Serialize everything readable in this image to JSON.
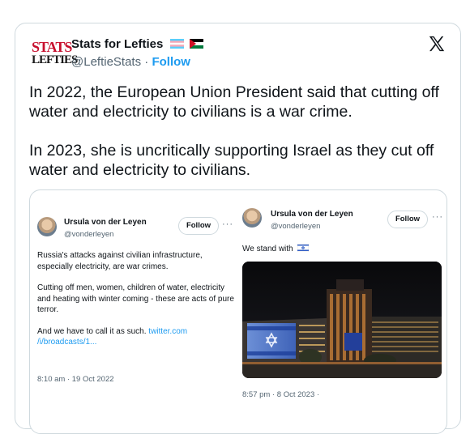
{
  "tweet": {
    "logo_line1": "STATS",
    "logo_line2": "LEFTIES",
    "author_name": "Stats for Lefties",
    "author_handle": "@LeftieStats",
    "separator": "·",
    "follow_label": "Follow",
    "paragraphs": [
      "In 2022, the European Union President said that cutting off water and electricity to civilians is a war crime.",
      "In 2023, she is uncritically supporting Israel as they cut off water and electricity to civilians."
    ]
  },
  "embedded_left": {
    "name": "Ursula von der Leyen",
    "handle": "@vonderleyen",
    "follow_label": "Follow",
    "more": "···",
    "p1": "Russia's attacks against civilian infrastructure, especially electricity, are war crimes.",
    "p2": "Cutting off men, women, children of water, electricity and heating with winter coming - these are acts of pure terror.",
    "p3_text": "And we have to call it as such. ",
    "p3_link": "twitter.com /i/broadcasts/1...",
    "timestamp": "8:10 am · 19 Oct 2022"
  },
  "embedded_right": {
    "name": "Ursula von der Leyen",
    "handle": "@vonderleyen",
    "follow_label": "Follow",
    "more": "···",
    "text": "We stand with",
    "timestamp": "8:57 pm · 8 Oct 2023 ·"
  },
  "colors": {
    "accent": "#1d9bf0",
    "muted": "#536471",
    "border": "#cfd9de"
  },
  "icons": [
    "x-logo-icon",
    "trans-flag-icon",
    "palestine-flag-icon",
    "israel-flag-icon"
  ]
}
